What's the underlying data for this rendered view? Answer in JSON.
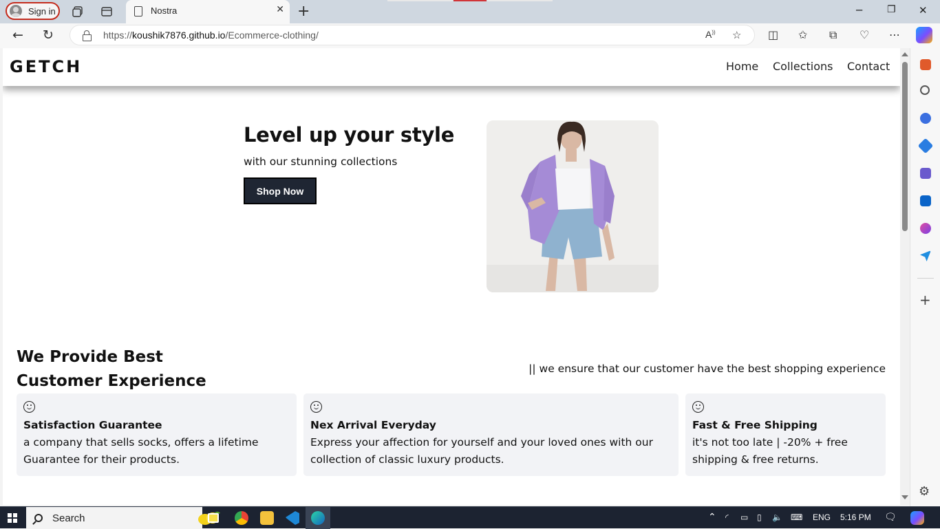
{
  "browser": {
    "signin_label": "Sign in",
    "tab_title": "Nostra",
    "url_prefix": "https://",
    "url_host": "koushik7876.github.io",
    "url_path": "/Ecommerce-clothing/"
  },
  "site": {
    "logo": "GETCH",
    "nav": [
      "Home",
      "Collections",
      "Contact"
    ]
  },
  "hero": {
    "title": "Level up your style",
    "subtitle": "with our stunning collections",
    "cta": "Shop Now"
  },
  "features": {
    "title": "We Provide Best Customer Experience",
    "note": "|| we ensure that our customer have the best shopping experience",
    "cards": [
      {
        "title": "Satisfaction Guarantee",
        "text": "a company that sells socks, offers a lifetime Guarantee for their products."
      },
      {
        "title": "Nex Arrival Everyday",
        "text": "Express your affection for yourself and your loved ones with our collection of classic luxury products."
      },
      {
        "title": "Fast & Free Shipping",
        "text": "it's not too late | -20% + free shipping & free returns."
      }
    ]
  },
  "taskbar": {
    "search_label": "Search",
    "language": "ENG",
    "time": "5:16 PM"
  },
  "colors": {
    "accent": "#c42b1c",
    "button_bg": "#1f2633",
    "card_bg": "#f2f3f6",
    "taskbar_bg": "#1c2331"
  }
}
